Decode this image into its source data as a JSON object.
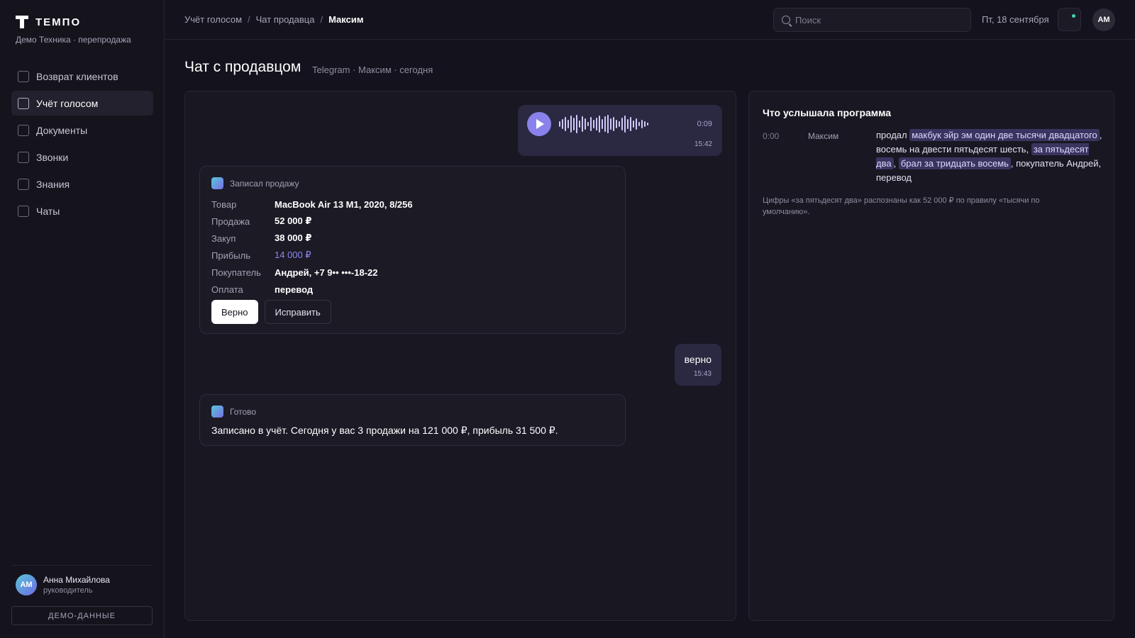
{
  "app": {
    "name": "ТЕМПО",
    "subtitle": "Демо Техника · перепродажа"
  },
  "sidebar": {
    "items": [
      {
        "label": "Возврат клиентов"
      },
      {
        "label": "Учёт голосом",
        "active": true
      },
      {
        "label": "Документы"
      },
      {
        "label": "Звонки"
      },
      {
        "label": "Знания"
      },
      {
        "label": "Чаты"
      }
    ],
    "user": {
      "initials": "АМ",
      "name": "Анна Михайлова",
      "role": "руководитель"
    },
    "demo_label": "ДЕМО-ДАННЫЕ"
  },
  "topbar": {
    "breadcrumbs": [
      "Учёт голосом",
      "Чат продавца",
      "Максим"
    ],
    "search_placeholder": "Поиск",
    "date": "Пт, 18 сентября",
    "avatar_initials": "АМ"
  },
  "page": {
    "title": "Чат с продавцом",
    "subtitle": "Telegram · Максим · сегодня"
  },
  "chat": {
    "voice": {
      "duration": "0:09",
      "time": "15:42"
    },
    "sale_card": {
      "header": "Записал продажу",
      "rows": [
        {
          "key": "Товар",
          "value": "MacBook Air 13 M1, 2020, 8/256"
        },
        {
          "key": "Продажа",
          "value": "52 000 ₽"
        },
        {
          "key": "Закуп",
          "value": "38 000 ₽"
        },
        {
          "key": "Прибыль",
          "value": "14 000 ₽"
        },
        {
          "key": "Покупатель",
          "value": "Андрей, +7 9•• •••-18-22"
        },
        {
          "key": "Оплата",
          "value": "перевод"
        }
      ],
      "confirm_label": "Верно",
      "edit_label": "Исправить"
    },
    "user_reply": {
      "text": "верно",
      "time": "15:43"
    },
    "done_card": {
      "header": "Готово",
      "text": "Записано в учёт. Сегодня у вас 3 продажи на 121 000 ₽, прибыль 31 500 ₽."
    }
  },
  "transcript": {
    "title": "Что услышала программа",
    "time": "0:00",
    "speaker": "Максим",
    "parts": [
      "продал ",
      "макбук эйр эм один две тысячи двадцатого",
      ", восемь на двести пятьдесят шесть, ",
      "за пятьдесят два",
      ", ",
      "брал за тридцать восемь",
      ", покупатель Андрей, перевод"
    ],
    "note": "Цифры «за пятьдесят два» распознаны как 52 000 ₽ по правилу «тысячи по умолчанию»."
  },
  "colors": {
    "accent": "#8a82ea",
    "background": "#14131d",
    "panel": "#181722",
    "highlight": "#3a3560",
    "status_dot": "#3ed6b7"
  },
  "icons": [
    "brand-logo-icon",
    "search-icon",
    "notification-icon",
    "play-icon",
    "bot-icon"
  ]
}
